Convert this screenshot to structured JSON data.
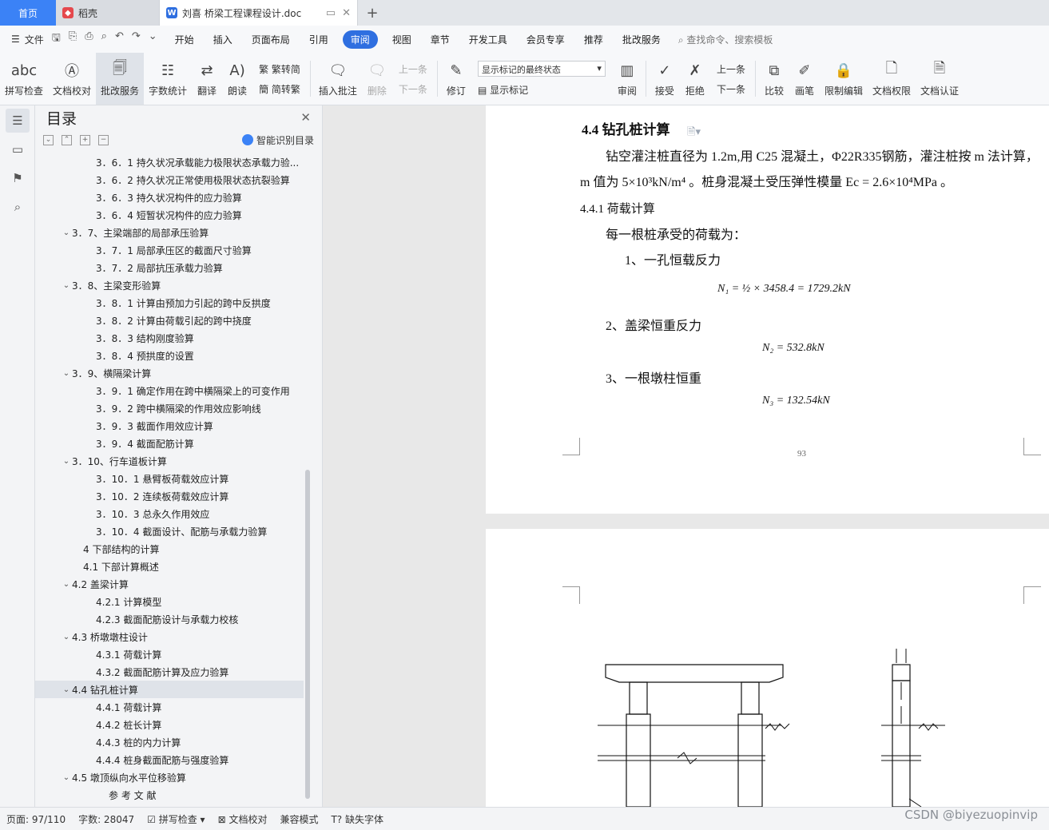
{
  "tabs": {
    "home": "首页",
    "draft": "稻壳",
    "doc": "刘喜 桥梁工程课程设计.doc",
    "add": "+"
  },
  "menu": {
    "file": "文件",
    "items": [
      "开始",
      "插入",
      "页面布局",
      "引用",
      "审阅",
      "视图",
      "章节",
      "开发工具",
      "会员专享",
      "推荐",
      "批改服务"
    ],
    "active": "审阅",
    "search": "查找命令、搜索模板"
  },
  "ribbon": {
    "spellcheck": "拼写检查",
    "proofread": "文档校对",
    "review_service": "批改服务",
    "word_count": "字数统计",
    "translate": "翻译",
    "read_aloud": "朗读",
    "trad_to_simp": "繁转简",
    "simp_to_trad": "简转繁",
    "insert_comment": "插入批注",
    "delete": "删除",
    "prev_comment": "上一条",
    "next_comment": "下一条",
    "track_changes": "修订",
    "state_select": "显示标记的最终状态",
    "show_markup": "显示标记",
    "review_pane": "审阅",
    "accept": "接受",
    "reject": "拒绝",
    "prev_change": "上一条",
    "next_change": "下一条",
    "compare": "比较",
    "pen": "画笔",
    "restrict_edit": "限制编辑",
    "doc_rights": "文档权限",
    "doc_certify": "文档认证"
  },
  "toc": {
    "title": "目录",
    "smart": "智能识别目录",
    "items": [
      {
        "text": "3．6．1 持久状况承载能力极限状态承载力验...",
        "level": 3,
        "arrow": ""
      },
      {
        "text": "3．6．2 持久状况正常使用极限状态抗裂验算",
        "level": 3,
        "arrow": ""
      },
      {
        "text": "3．6．3 持久状况构件的应力验算",
        "level": 3,
        "arrow": ""
      },
      {
        "text": "3．6．4 短暂状况构件的应力验算",
        "level": 3,
        "arrow": ""
      },
      {
        "text": "3．7、主梁端部的局部承压验算",
        "level": 2,
        "arrow": "v"
      },
      {
        "text": "3．7．1 局部承压区的截面尺寸验算",
        "level": 3,
        "arrow": ""
      },
      {
        "text": "3．7．2 局部抗压承载力验算",
        "level": 3,
        "arrow": ""
      },
      {
        "text": "3．8、主梁变形验算",
        "level": 2,
        "arrow": "v"
      },
      {
        "text": "3．8．1 计算由预加力引起的跨中反拱度",
        "level": 3,
        "arrow": ""
      },
      {
        "text": "3．8．2 计算由荷载引起的跨中挠度",
        "level": 3,
        "arrow": ""
      },
      {
        "text": "3．8．3 结构刚度验算",
        "level": 3,
        "arrow": ""
      },
      {
        "text": "3．8．4 预拱度的设置",
        "level": 3,
        "arrow": ""
      },
      {
        "text": "3．9、横隔梁计算",
        "level": 2,
        "arrow": "v"
      },
      {
        "text": "3．9．1 确定作用在跨中横隔梁上的可变作用",
        "level": 3,
        "arrow": ""
      },
      {
        "text": "3．9．2 跨中横隔梁的作用效应影响线",
        "level": 3,
        "arrow": ""
      },
      {
        "text": "3．9．3 截面作用效应计算",
        "level": 3,
        "arrow": ""
      },
      {
        "text": "3．9．4 截面配筋计算",
        "level": 3,
        "arrow": ""
      },
      {
        "text": "3．10、行车道板计算",
        "level": 2,
        "arrow": "v"
      },
      {
        "text": "3．10．1 悬臂板荷载效应计算",
        "level": 3,
        "arrow": ""
      },
      {
        "text": "3．10．2 连续板荷载效应计算",
        "level": 3,
        "arrow": ""
      },
      {
        "text": "3．10．3 总永久作用效应",
        "level": 3,
        "arrow": ""
      },
      {
        "text": "3．10．4 截面设计、配筋与承载力验算",
        "level": 3,
        "arrow": ""
      },
      {
        "text": "4 下部结构的计算",
        "level": 1,
        "arrow": ""
      },
      {
        "text": "4.1 下部计算概述",
        "level": 1,
        "arrow": ""
      },
      {
        "text": "4.2 盖梁计算",
        "level": 2,
        "arrow": "v"
      },
      {
        "text": "4.2.1 计算模型",
        "level": 3,
        "arrow": ""
      },
      {
        "text": "4.2.3 截面配筋设计与承载力校核",
        "level": 3,
        "arrow": ""
      },
      {
        "text": "4.3 桥墩墩柱设计",
        "level": 2,
        "arrow": "v"
      },
      {
        "text": "4.3.1 荷载计算",
        "level": 3,
        "arrow": ""
      },
      {
        "text": "4.3.2 截面配筋计算及应力验算",
        "level": 3,
        "arrow": ""
      },
      {
        "text": "4.4 钻孔桩计算",
        "level": 2,
        "arrow": "v",
        "selected": true
      },
      {
        "text": "4.4.1 荷载计算",
        "level": 3,
        "arrow": ""
      },
      {
        "text": "4.4.2 桩长计算",
        "level": 3,
        "arrow": ""
      },
      {
        "text": "4.4.3 桩的内力计算",
        "level": 3,
        "arrow": ""
      },
      {
        "text": "4.4.4 桩身截面配筋与强度验算",
        "level": 3,
        "arrow": ""
      },
      {
        "text": "4.5 墩顶纵向水平位移验算",
        "level": 2,
        "arrow": "v"
      },
      {
        "text": "参 考 文 献",
        "level": 4,
        "arrow": ""
      }
    ]
  },
  "doc": {
    "heading": "4.4   钻孔桩计算",
    "para1": "钻空灌注桩直径为 1.2m,用 C25 混凝土，Φ22R335钢筋，灌注桩按 m 法计算，",
    "para2": "m 值为 5×10³kN/m⁴ 。桩身混凝土受压弹性模量 Ec = 2.6×10⁴MPa 。",
    "sub_heading": "4.4.1 荷载计算",
    "intro": "每一根桩承受的荷载为：",
    "item1": "1、一孔恒载反力",
    "eq1": "N₁ = ½ × 3458.4 = 1729.2kN",
    "item2": "2、盖梁恒重反力",
    "eq2": "N₂ = 532.8kN",
    "item3": "3、一根墩柱恒重",
    "eq3": "N₃ = 132.54kN",
    "page_number": "93"
  },
  "status": {
    "page": "页面: 97/110",
    "words": "字数: 28047",
    "spell": "拼写检查",
    "proof": "文档校对",
    "compat": "兼容模式",
    "missing_font": "缺失字体"
  },
  "watermark": "CSDN @biyezuopinvip"
}
